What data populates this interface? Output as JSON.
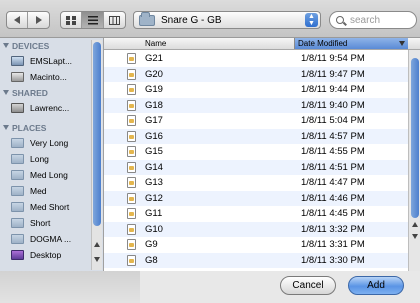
{
  "toolbar": {
    "back_icon": "back-arrow-icon",
    "forward_icon": "forward-arrow-icon",
    "view_modes": [
      "icon-view",
      "list-view",
      "column-view"
    ],
    "location": "Snare G - GB",
    "search_placeholder": "search"
  },
  "sidebar": {
    "sections": [
      {
        "title": "DEVICES",
        "items": [
          {
            "label": "EMSLapt...",
            "icon": "laptop-icon"
          },
          {
            "label": "Macinto...",
            "icon": "hard-drive-icon"
          }
        ]
      },
      {
        "title": "SHARED",
        "items": [
          {
            "label": "Lawrenc...",
            "icon": "network-computer-icon"
          }
        ]
      },
      {
        "title": "PLACES",
        "items": [
          {
            "label": "Very Long",
            "icon": "folder-icon"
          },
          {
            "label": "Long",
            "icon": "folder-icon"
          },
          {
            "label": "Med Long",
            "icon": "folder-icon"
          },
          {
            "label": "Med",
            "icon": "folder-icon"
          },
          {
            "label": "Med Short",
            "icon": "folder-icon"
          },
          {
            "label": "Short",
            "icon": "folder-icon"
          },
          {
            "label": "DOGMA ...",
            "icon": "folder-icon"
          },
          {
            "label": "Desktop",
            "icon": "desktop-icon"
          }
        ]
      }
    ]
  },
  "list": {
    "columns": {
      "name": "Name",
      "date": "Date Modified"
    },
    "rows": [
      {
        "name": "G21",
        "date": "1/8/11 9:54 PM"
      },
      {
        "name": "G20",
        "date": "1/8/11 9:47 PM"
      },
      {
        "name": "G19",
        "date": "1/8/11 9:44 PM"
      },
      {
        "name": "G18",
        "date": "1/8/11 9:40 PM"
      },
      {
        "name": "G17",
        "date": "1/8/11 5:04 PM"
      },
      {
        "name": "G16",
        "date": "1/8/11 4:57 PM"
      },
      {
        "name": "G15",
        "date": "1/8/11 4:55 PM"
      },
      {
        "name": "G14",
        "date": "1/8/11 4:51 PM"
      },
      {
        "name": "G13",
        "date": "1/8/11 4:47 PM"
      },
      {
        "name": "G12",
        "date": "1/8/11 4:46 PM"
      },
      {
        "name": "G11",
        "date": "1/8/11 4:45 PM"
      },
      {
        "name": "G10",
        "date": "1/8/11 3:32 PM"
      },
      {
        "name": "G9",
        "date": "1/8/11 3:31 PM"
      },
      {
        "name": "G8",
        "date": "1/8/11 3:30 PM"
      }
    ]
  },
  "buttons": {
    "cancel": "Cancel",
    "add": "Add"
  },
  "colors": {
    "accent": "#5a8ad6",
    "sidebar_bg": "#d8dee7",
    "row_stripe": "#edf3fe"
  }
}
